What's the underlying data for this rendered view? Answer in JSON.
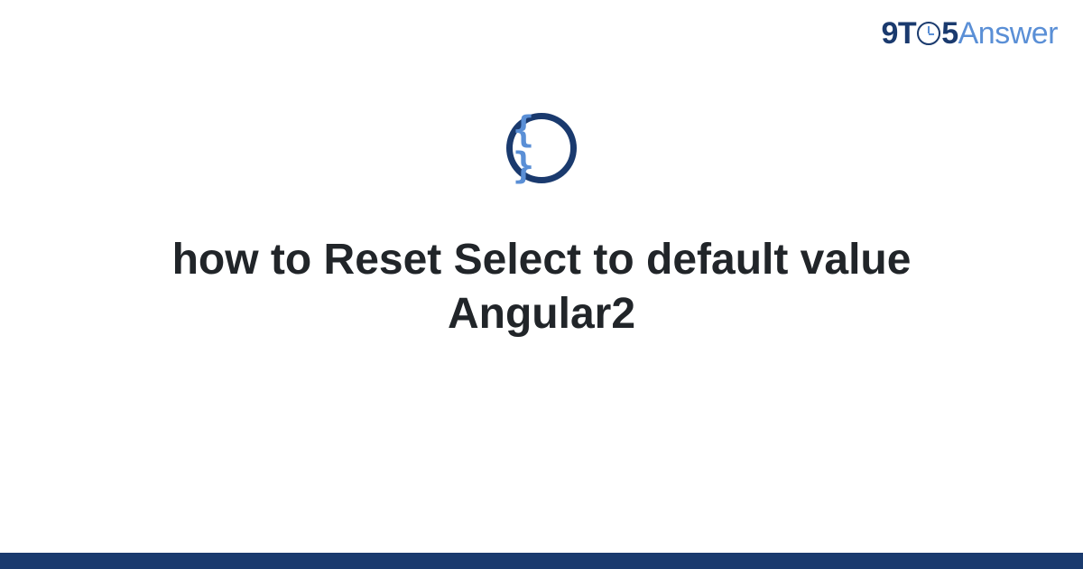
{
  "header": {
    "logo": {
      "part1": "9T",
      "part2": "5",
      "part3": "Answer"
    }
  },
  "main": {
    "icon_glyph": "{ }",
    "title": "how to Reset Select to default value Angular2"
  },
  "colors": {
    "brand_dark": "#1a3a6e",
    "brand_light": "#5a8fd6",
    "text": "#212529"
  }
}
